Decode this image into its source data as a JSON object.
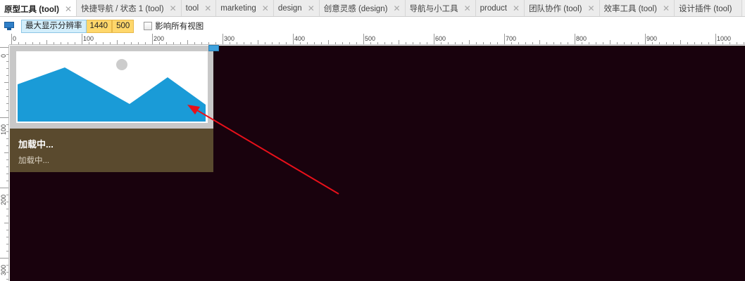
{
  "tabs": [
    {
      "label": "原型工具 (tool)",
      "active": true
    },
    {
      "label": "快捷导航 / 状态 1 (tool)",
      "active": false
    },
    {
      "label": "tool",
      "active": false
    },
    {
      "label": "marketing",
      "active": false
    },
    {
      "label": "design",
      "active": false
    },
    {
      "label": "创意灵感 (design)",
      "active": false
    },
    {
      "label": "导航与小工具",
      "active": false
    },
    {
      "label": "product",
      "active": false
    },
    {
      "label": "团队协作 (tool)",
      "active": false
    },
    {
      "label": "效率工具 (tool)",
      "active": false
    },
    {
      "label": "设计插件 (tool)",
      "active": false
    }
  ],
  "tab_close_glyph": "✕",
  "toolbar": {
    "device_icon": "monitor-icon",
    "breakpoint_label": "最大显示分辨率",
    "breakpoint_values": [
      "1440",
      "500"
    ],
    "checkbox_label": "影响所有视图",
    "checkbox_checked": false
  },
  "ruler": {
    "horizontal_labels": [
      "0",
      "100",
      "200",
      "300",
      "400",
      "500",
      "600",
      "700",
      "800",
      "900",
      "1000"
    ],
    "vertical_labels": [
      "0",
      "100",
      "200",
      "300"
    ]
  },
  "card": {
    "title": "加载中...",
    "subtitle": "加载中...",
    "image_icon": "image-placeholder-icon"
  },
  "colors": {
    "canvas": "#19020d",
    "card_body": "#5a4a2e",
    "mountain": "#1a9bd7",
    "sun": "#cccccc",
    "arrow": "#e8101a",
    "breakpoint_label_bg": "#d3eefb",
    "breakpoint_value_bg": "#ffd76b"
  }
}
